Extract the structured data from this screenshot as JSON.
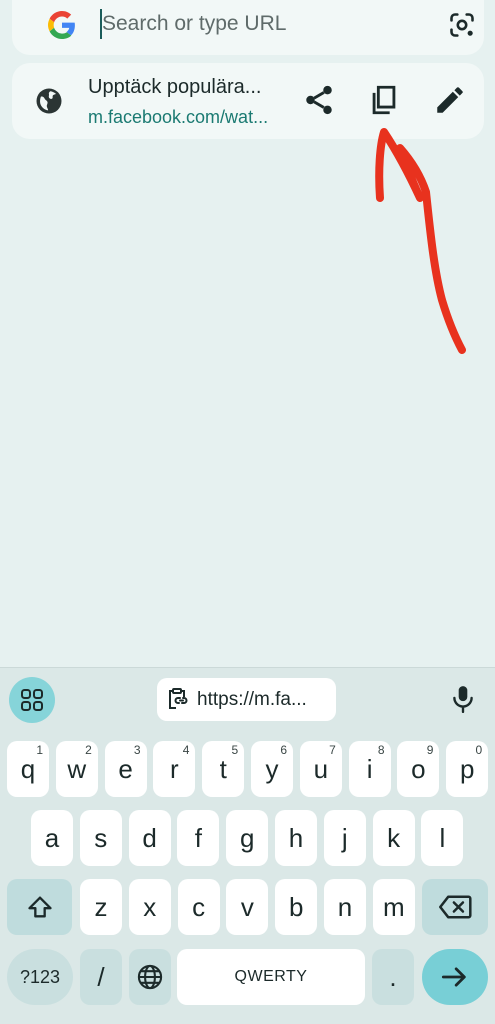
{
  "omnibox": {
    "placeholder": "Search or type URL",
    "left_icon": "google-g-icon",
    "right_icon": "google-lens-icon"
  },
  "suggestion": {
    "title": "Upptäck populära...",
    "url": "m.facebook.com/wat...",
    "icons": [
      "globe-icon",
      "share-icon",
      "copy-icon",
      "edit-icon"
    ]
  },
  "keyboard": {
    "clipboard_chip": "https://m.fa...",
    "row1": [
      {
        "k": "q",
        "h": "1"
      },
      {
        "k": "w",
        "h": "2"
      },
      {
        "k": "e",
        "h": "3"
      },
      {
        "k": "r",
        "h": "4"
      },
      {
        "k": "t",
        "h": "5"
      },
      {
        "k": "y",
        "h": "6"
      },
      {
        "k": "u",
        "h": "7"
      },
      {
        "k": "i",
        "h": "8"
      },
      {
        "k": "o",
        "h": "9"
      },
      {
        "k": "p",
        "h": "0"
      }
    ],
    "row2": [
      "a",
      "s",
      "d",
      "f",
      "g",
      "h",
      "j",
      "k",
      "l"
    ],
    "row3": [
      "z",
      "x",
      "c",
      "v",
      "b",
      "n",
      "m"
    ],
    "symbols_key": "?123",
    "slash_key": "/",
    "space_key": "QWERTY",
    "period_key": "."
  },
  "colors": {
    "background": "#e6f1f0",
    "url_text": "#1b7a72",
    "annotation_arrow": "#e8321e",
    "enter_key": "#78cfd6"
  }
}
